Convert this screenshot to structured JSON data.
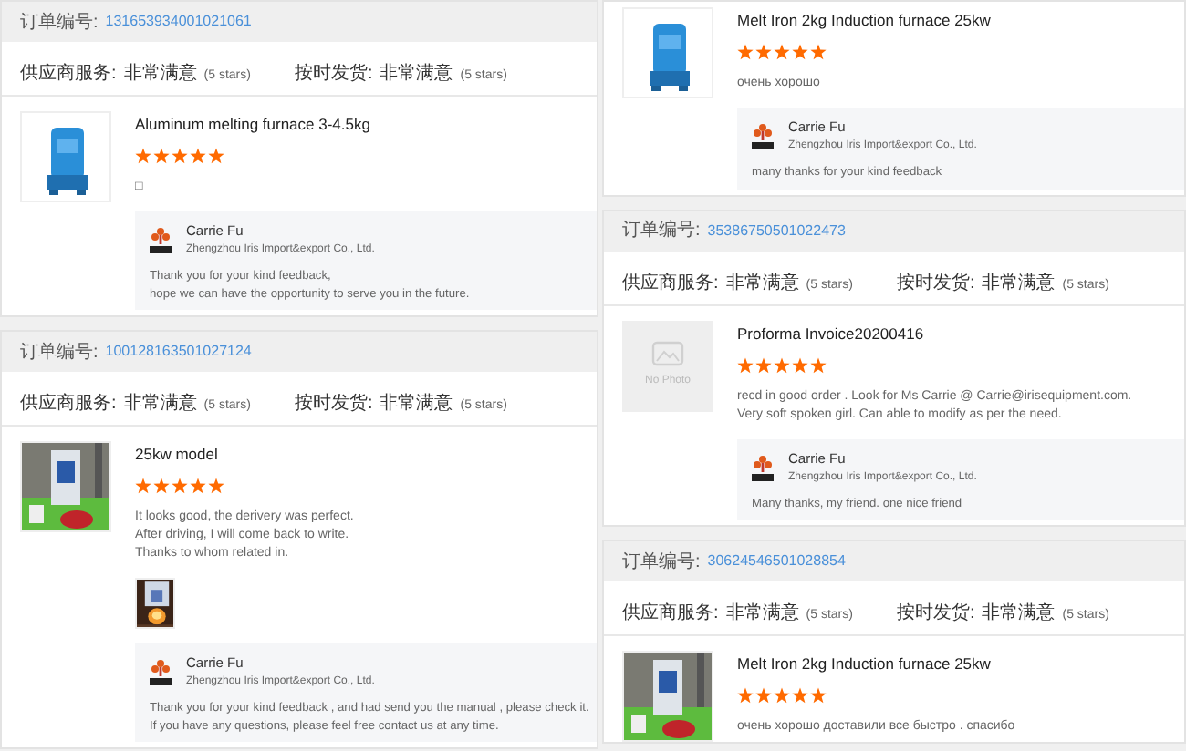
{
  "columns": [
    {
      "cards": [
        {
          "order": {
            "label": "订单编号:",
            "number": "131653934001021061"
          },
          "ratings": [
            {
              "label": "供应商服务:",
              "value": "非常满意",
              "note": "(5 stars)"
            },
            {
              "label": "按时发货:",
              "value": "非常满意",
              "note": "(5 stars)"
            }
          ],
          "product": {
            "image": {
              "kind": "picture"
            },
            "title": "Aluminum melting furnace 3-4.5kg",
            "stars": 5,
            "review": "□"
          },
          "reply": {
            "name": "Carrie Fu",
            "company": "Zhengzhou Iris Import&export Co., Ltd.",
            "text": "Thank you for your kind feedback,\nhope we can have the opportunity to serve you in the future."
          }
        },
        {
          "order": {
            "label": "订单编号:",
            "number": "100128163501027124"
          },
          "ratings": [
            {
              "label": "供应商服务:",
              "value": "非常满意",
              "note": "(5 stars)"
            },
            {
              "label": "按时发货:",
              "value": "非常满意",
              "note": "(5 stars)"
            }
          ],
          "product": {
            "image": {
              "kind": "picture"
            },
            "title": "25kw model",
            "stars": 5,
            "review": "It looks good, the derivery was perfect.\nAfter driving, I will come back to write.\nThanks to whom related in.",
            "thumbnails": [
              {
                "kind": "picture"
              }
            ]
          },
          "reply": {
            "name": "Carrie Fu",
            "company": "Zhengzhou Iris Import&export Co., Ltd.",
            "text": "Thank you for your kind feedback , and had send you the manual , please check it.\nIf you have any questions, please  feel free contact us at any time."
          }
        }
      ]
    },
    {
      "cards": [
        {
          "product": {
            "image": {
              "kind": "picture"
            },
            "title": "Melt Iron 2kg Induction furnace 25kw",
            "stars": 5,
            "review": "очень хорошо"
          },
          "reply": {
            "name": "Carrie Fu",
            "company": "Zhengzhou Iris Import&export Co., Ltd.",
            "text": "many thanks for your kind feedback"
          }
        },
        {
          "order": {
            "label": "订单编号:",
            "number": "35386750501022473"
          },
          "ratings": [
            {
              "label": "供应商服务:",
              "value": "非常满意",
              "note": "(5 stars)"
            },
            {
              "label": "按时发货:",
              "value": "非常满意",
              "note": "(5 stars)"
            }
          ],
          "product": {
            "image": {
              "kind": "no_photo",
              "label": "No Photo"
            },
            "title": "Proforma Invoice20200416",
            "stars": 5,
            "review": "recd in good  order . Look for Ms Carrie @ Carrie@irisequipment.com.\nVery soft spoken girl. Can able to modify as per the need."
          },
          "reply": {
            "name": "Carrie Fu",
            "company": "Zhengzhou Iris Import&export Co., Ltd.",
            "text": "Many thanks, my friend. one nice friend"
          }
        },
        {
          "order": {
            "label": "订单编号:",
            "number": "30624546501028854"
          },
          "ratings": [
            {
              "label": "供应商服务:",
              "value": "非常满意",
              "note": "(5 stars)"
            },
            {
              "label": "按时发货:",
              "value": "非常满意",
              "note": "(5 stars)"
            }
          ],
          "product": {
            "image": {
              "kind": "picture"
            },
            "title": "Melt Iron 2kg Induction furnace 25kw",
            "stars": 5,
            "review": "очень хорошо  доставили все  быстро . спасибо"
          }
        }
      ]
    }
  ]
}
